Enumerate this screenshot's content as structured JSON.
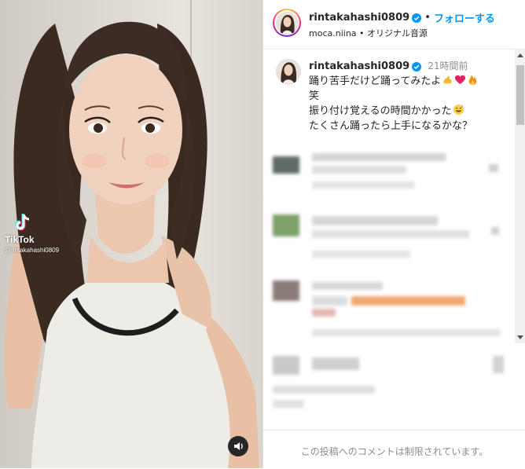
{
  "post": {
    "username": "rintakahashi0809",
    "follow_label": "フォローする",
    "separator": "•",
    "audio_user": "moca.niina",
    "audio_label": "オリジナル音源",
    "time_ago": "21時間前",
    "caption_lines": [
      "踊り苦手だけど踊ってみたよ",
      "笑",
      "振り付け覚えるの時間かかった",
      "たくさん踊ったら上手になるかな？"
    ],
    "comments_restricted": "この投稿へのコメントは制限されています。"
  },
  "media": {
    "watermark_name": "TikTok",
    "watermark_user": "@rintakahashi0809"
  },
  "icons": {
    "verified": "verified-badge-icon",
    "sound": "speaker-icon",
    "tiktok": "tiktok-logo-icon",
    "caption_emojis": [
      "flexed-biceps-emoji",
      "red-heart-emoji",
      "fire-emoji"
    ],
    "caption_emoji_line2": "grinning-sweat-emoji"
  },
  "colors": {
    "accent": "#0095f6",
    "muted": "#8e8e8e",
    "text": "#262626"
  }
}
